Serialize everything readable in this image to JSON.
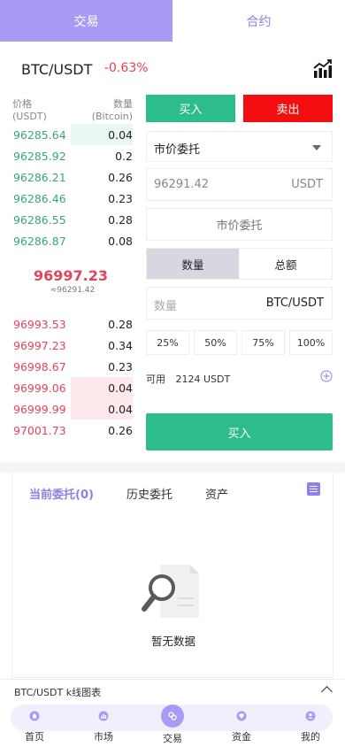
{
  "tabs": {
    "trade": "交易",
    "contract": "合约"
  },
  "pair": {
    "name": "BTC/USDT",
    "change": "-0.63%"
  },
  "orderbook": {
    "price_label": "价格",
    "price_unit": "(USDT)",
    "qty_label": "数量",
    "qty_unit": "(Bitcoin)",
    "buys": [
      {
        "price": "96285.64",
        "qty": "0.04",
        "depth": 0.5
      },
      {
        "price": "96285.92",
        "qty": "0.2",
        "depth": 0
      },
      {
        "price": "96286.21",
        "qty": "0.26",
        "depth": 0
      },
      {
        "price": "96286.46",
        "qty": "0.23",
        "depth": 0
      },
      {
        "price": "96286.55",
        "qty": "0.28",
        "depth": 0
      },
      {
        "price": "96286.87",
        "qty": "0.08",
        "depth": 0
      }
    ],
    "mid_price": "96997.23",
    "mid_sub": "≈96291.42",
    "sells": [
      {
        "price": "96993.53",
        "qty": "0.28",
        "depth": 0
      },
      {
        "price": "96997.23",
        "qty": "0.34",
        "depth": 0
      },
      {
        "price": "96998.67",
        "qty": "0.23",
        "depth": 0
      },
      {
        "price": "96999.06",
        "qty": "0.04",
        "depth": 0.5
      },
      {
        "price": "96999.99",
        "qty": "0.04",
        "depth": 0.5
      },
      {
        "price": "97001.73",
        "qty": "0.26",
        "depth": 0
      }
    ]
  },
  "form": {
    "buy_label": "买入",
    "sell_label": "卖出",
    "order_type": "市价委托",
    "price_value": "96291.42",
    "price_unit": "USDT",
    "market_label": "市价委托",
    "mode_amount": "数量",
    "mode_total": "总额",
    "amount_placeholder": "数量",
    "amount_unit": "BTC/USDT",
    "percents": [
      "25%",
      "50%",
      "75%",
      "100%"
    ],
    "available_label": "可用",
    "available_value": "2124 USDT",
    "submit_label": "买入"
  },
  "orders": {
    "tabs": [
      "当前委托(0)",
      "历史委托",
      "资产"
    ],
    "empty_text": "暂无数据"
  },
  "kline": {
    "label": "BTC/USDT k线图表"
  },
  "nav": [
    {
      "label": "首页",
      "icon": "home-icon"
    },
    {
      "label": "市场",
      "icon": "market-icon"
    },
    {
      "label": "交易",
      "icon": "trade-icon"
    },
    {
      "label": "资金",
      "icon": "funds-icon"
    },
    {
      "label": "我的",
      "icon": "profile-icon"
    }
  ],
  "colors": {
    "accent": "#a99bf5",
    "buy": "#2dbd8b",
    "sell": "#f30f0f",
    "up_text": "#3aa776",
    "down_text": "#e0455b"
  }
}
